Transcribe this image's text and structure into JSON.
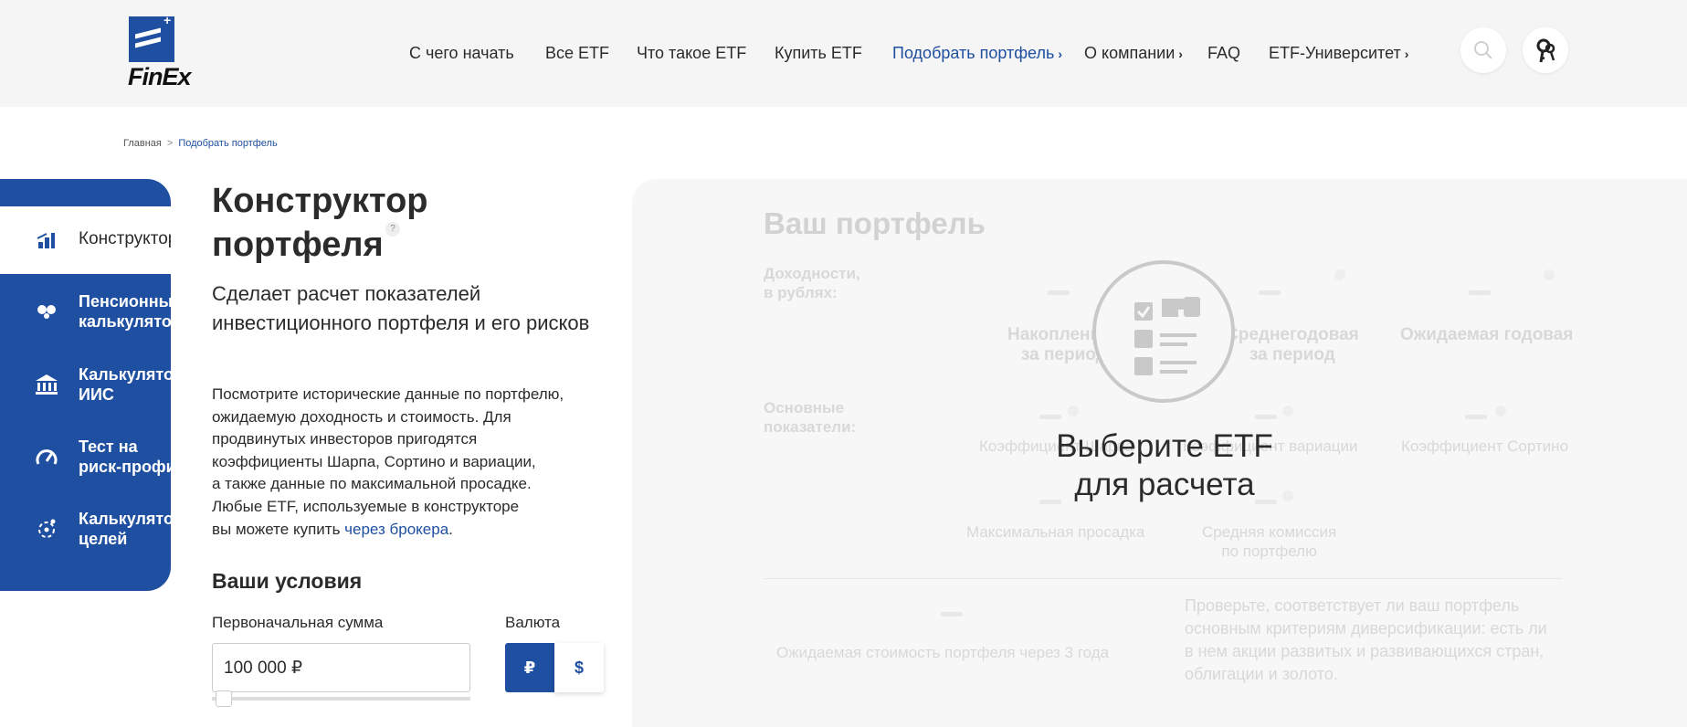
{
  "header": {
    "logo_text": "FinEx",
    "nav": [
      {
        "label": "С чего начать"
      },
      {
        "label": "Все ETF"
      },
      {
        "label": "Что такое ETF"
      },
      {
        "label": "Купить ETF"
      },
      {
        "label": "Подобрать портфель",
        "active": true,
        "chevron": "›"
      },
      {
        "label": "О компании",
        "chevron": "›"
      },
      {
        "label": "FAQ"
      },
      {
        "label": "ETF-Университет",
        "chevron": "›"
      }
    ]
  },
  "breadcrumb": {
    "home": "Главная",
    "separator": ">",
    "current": "Подобрать портфель"
  },
  "sidebar": {
    "items": [
      {
        "label": "Конструктор",
        "icon": "constructor-icon",
        "active": true
      },
      {
        "label": "Пенсионный\nкалькулятор",
        "icon": "pension-icon"
      },
      {
        "label": "Калькулятор\nИИС",
        "icon": "bank-icon"
      },
      {
        "label": "Тест на\nриск-профиль",
        "icon": "gauge-icon"
      },
      {
        "label": "Калькулятор\nцелей",
        "icon": "goals-icon"
      }
    ]
  },
  "main": {
    "title": "Конструктор\nпортфеля",
    "help": "?",
    "subtitle": "Сделает расчет показателей инвестиционного портфеля и его рисков",
    "description_lines": [
      "Посмотрите исторические данные по портфелю,",
      "ожидаемую доходность и стоимость. Для",
      "продвинутых инвесторов пригодятся",
      "коэффициенты Шарпа, Сортино и вариации,",
      "а также данные по максимальной просадке.",
      "Любые ETF, используемые в конструкторе"
    ],
    "description_last": "вы можете купить ",
    "description_link": "через брокера",
    "description_end": ".",
    "conditions_title": "Ваши условия",
    "initial_amount_label": "Первоначальная сумма",
    "initial_amount_value": "100 000 ₽",
    "currency_label": "Валюта",
    "currency_rub": "₽",
    "currency_usd": "$"
  },
  "portfolio": {
    "title": "Ваш портфель",
    "returns_label": "Доходности,\nв рублях:",
    "returns_accum": "Накопленная\nза период",
    "returns_avg": "Среднегодовая\nза период",
    "returns_expected": "Ожидаемая годовая",
    "metrics_label": "Основные\nпоказатели:",
    "metric_sharpe": "Коэффициент Шарпа",
    "metric_variation": "Коэффициент вариации",
    "metric_sortino": "Коэффициент Сортино",
    "metric_drawdown": "Максимальная просадка",
    "metric_fee": "Средняя комиссия\nпо портфелю",
    "expected_value": "Ожидаемая стоимость портфеля через 3 года",
    "diversification_text": "Проверьте, соответствует ли ваш портфель\nосновным критериям диверсификации: есть ли\nв нем акции развитых и развивающихся стран,\nоблигации и золото.",
    "empty_state": "Выберите ETF\nдля расчета"
  }
}
